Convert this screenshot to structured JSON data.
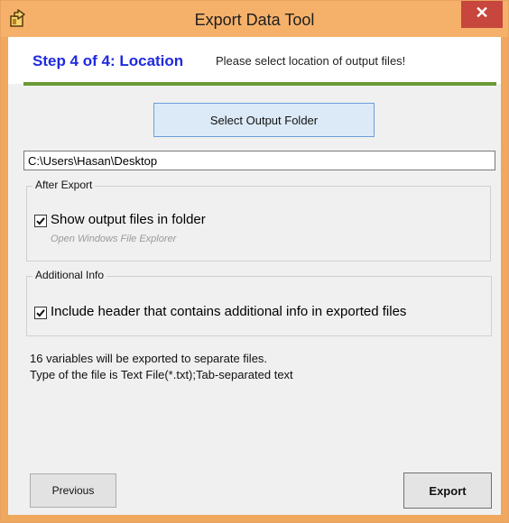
{
  "window": {
    "title": "Export Data Tool",
    "close_label": "✕",
    "app_icon": "export-hand-icon"
  },
  "header": {
    "step": "Step 4 of 4: Location",
    "description": "Please select location of output files!"
  },
  "folder_button": {
    "label": "Select Output Folder"
  },
  "path_field": {
    "value": "C:\\Users\\Hasan\\Desktop"
  },
  "after_export": {
    "title": "After Export",
    "checkbox_label": "Show output files in folder",
    "checked": true,
    "hint": "Open Windows File Explorer"
  },
  "additional_info": {
    "title": "Additional Info",
    "checkbox_label": "Include header that contains additional info in exported files",
    "checked": true
  },
  "summary": {
    "line1": "16 variables will be exported to separate files.",
    "line2": "Type of the file is Text File(*.txt);Tab-separated text"
  },
  "buttons": {
    "previous": "Previous",
    "export": "Export"
  },
  "colors": {
    "title_bar": "#f5b16a",
    "close_button": "#c7463d",
    "step_text": "#1f2ae0",
    "divider": "#6a9a35",
    "primary_button_bg": "#dceaf7"
  }
}
